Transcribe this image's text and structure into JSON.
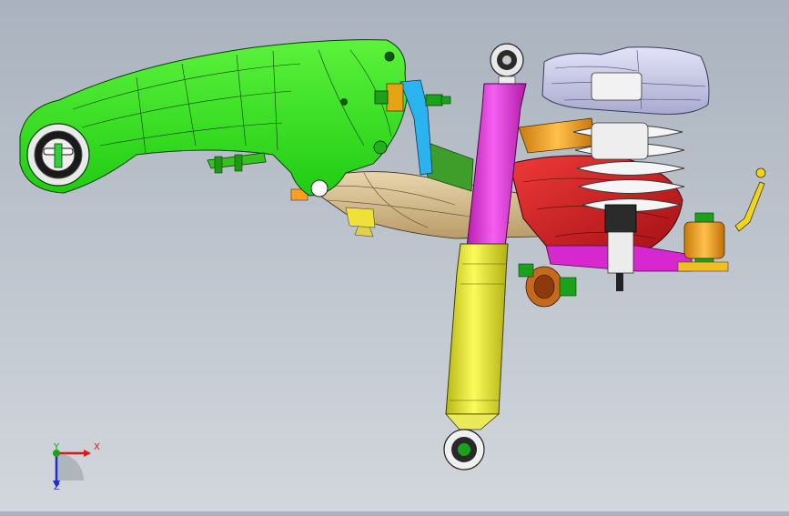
{
  "viewport": {
    "background_top": "#a9b2be",
    "background_bottom": "#d2d7dd"
  },
  "triad": {
    "x_label": "X",
    "y_label": "Y",
    "z_label": "Z",
    "x_color": "#e01818",
    "y_color": "#17a31a",
    "z_color": "#1a2fd0"
  },
  "parts": [
    {
      "name": "lower-control-arm",
      "color": "#33e61a"
    },
    {
      "name": "shock-absorber-upper-body",
      "color": "#e633d9"
    },
    {
      "name": "shock-absorber-lower-body",
      "color": "#e6e633"
    },
    {
      "name": "coil-spring",
      "color": "#f2f2f2"
    },
    {
      "name": "top-mount",
      "color": "#c8c8e6"
    },
    {
      "name": "knuckle",
      "color": "#d41d1d"
    },
    {
      "name": "subframe-member",
      "color": "#d9bf8c"
    },
    {
      "name": "bushing-orange",
      "color": "#f2a31a"
    }
  ]
}
